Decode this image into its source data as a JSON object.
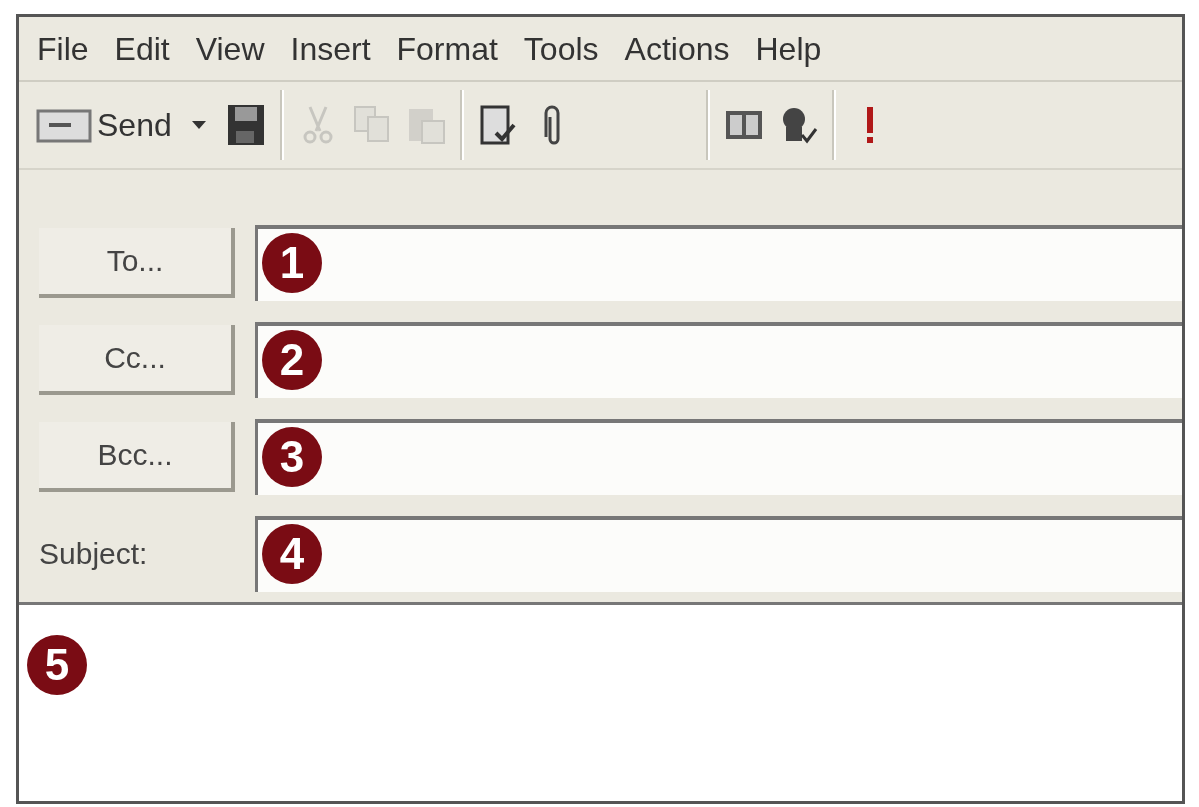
{
  "menu": [
    "File",
    "Edit",
    "View",
    "Insert",
    "Format",
    "Tools",
    "Actions",
    "Help"
  ],
  "toolbar": [
    {
      "kind": "send",
      "label": "Send",
      "disabled": false
    },
    {
      "kind": "caret",
      "disabled": false
    },
    {
      "kind": "save",
      "disabled": false
    },
    {
      "kind": "sep"
    },
    {
      "kind": "cut",
      "disabled": true
    },
    {
      "kind": "copy",
      "disabled": true
    },
    {
      "kind": "paste",
      "disabled": true
    },
    {
      "kind": "sep"
    },
    {
      "kind": "check",
      "disabled": false
    },
    {
      "kind": "attach",
      "disabled": false
    },
    {
      "kind": "sep"
    },
    {
      "kind": "book",
      "disabled": false
    },
    {
      "kind": "names",
      "disabled": false
    },
    {
      "kind": "sep"
    },
    {
      "kind": "importance",
      "disabled": false
    }
  ],
  "fields": [
    {
      "kind": "button",
      "label": "To...",
      "callout": "1"
    },
    {
      "kind": "button",
      "label": "Cc...",
      "callout": "2"
    },
    {
      "kind": "button",
      "label": "Bcc...",
      "callout": "3"
    },
    {
      "kind": "label",
      "label": "Subject:",
      "callout": "4"
    }
  ],
  "body": {
    "callout": "5"
  }
}
